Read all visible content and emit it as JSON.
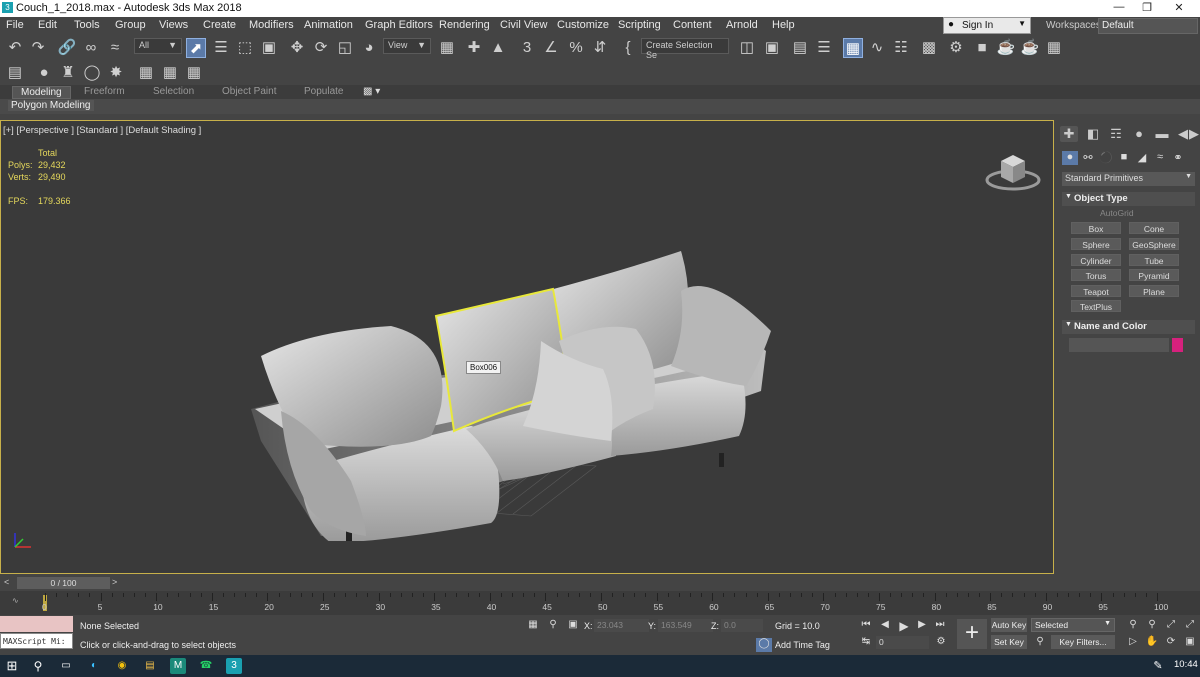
{
  "window": {
    "title": "Couch_1_2018.max - Autodesk 3ds Max 2018",
    "app_icon_label": "3"
  },
  "menu": [
    "File",
    "Edit",
    "Tools",
    "Group",
    "Views",
    "Create",
    "Modifiers",
    "Animation",
    "Graph Editors",
    "Rendering",
    "Civil View",
    "Customize",
    "Scripting",
    "Content",
    "Arnold",
    "Help"
  ],
  "account": {
    "signin_label": "Sign In",
    "workspaces_label": "Workspaces:",
    "workspace_value": "Default"
  },
  "toolbar": {
    "filter_value": "All",
    "refcoord_value": "View",
    "selection_set_placeholder": "Create Selection Se"
  },
  "ribbon": {
    "tabs": [
      "Modeling",
      "Freeform",
      "Selection",
      "Object Paint",
      "Populate"
    ],
    "active_panel": "Polygon Modeling"
  },
  "viewport": {
    "label": "[+] [Perspective ] [Standard ] [Default Shading ]",
    "stats": {
      "total_label": "Total",
      "polys_label": "Polys:",
      "polys": "29,432",
      "verts_label": "Verts:",
      "verts": "29,490",
      "fps_label": "FPS:",
      "fps": "179.366"
    },
    "tooltip": "Box006",
    "colors": {
      "frame": "#c7b04a",
      "selection": "#e8e83a"
    }
  },
  "command_panel": {
    "dropdown": "Standard Primitives",
    "object_type_title": "Object Type",
    "autogrid": "AutoGrid",
    "buttons": [
      "Box",
      "Cone",
      "Sphere",
      "GeoSphere",
      "Cylinder",
      "Tube",
      "Torus",
      "Pyramid",
      "Teapot",
      "Plane",
      "TextPlus"
    ],
    "name_color_title": "Name and Color",
    "swatch_color": "#d6217d"
  },
  "timeline": {
    "slider": "0 / 100",
    "ticks": [
      "0",
      "5",
      "10",
      "15",
      "20",
      "25",
      "30",
      "35",
      "40",
      "45",
      "50",
      "55",
      "60",
      "65",
      "70",
      "75",
      "80",
      "85",
      "90",
      "95",
      "100"
    ]
  },
  "status": {
    "maxscript": "MAXScript Mi:",
    "selection": "None Selected",
    "prompt": "Click or click-and-drag to select objects",
    "x_label": "X:",
    "x": "23.043",
    "y_label": "Y:",
    "y": "163.549",
    "z_label": "Z:",
    "z": "0.0",
    "grid": "Grid = 10.0",
    "add_time_tag": "Add Time Tag",
    "frame": "0",
    "auto_key": "Auto Key",
    "set_key": "Set Key",
    "key_mode": "Selected",
    "key_filters": "Key Filters..."
  },
  "taskbar": {
    "clock": "10:44"
  }
}
